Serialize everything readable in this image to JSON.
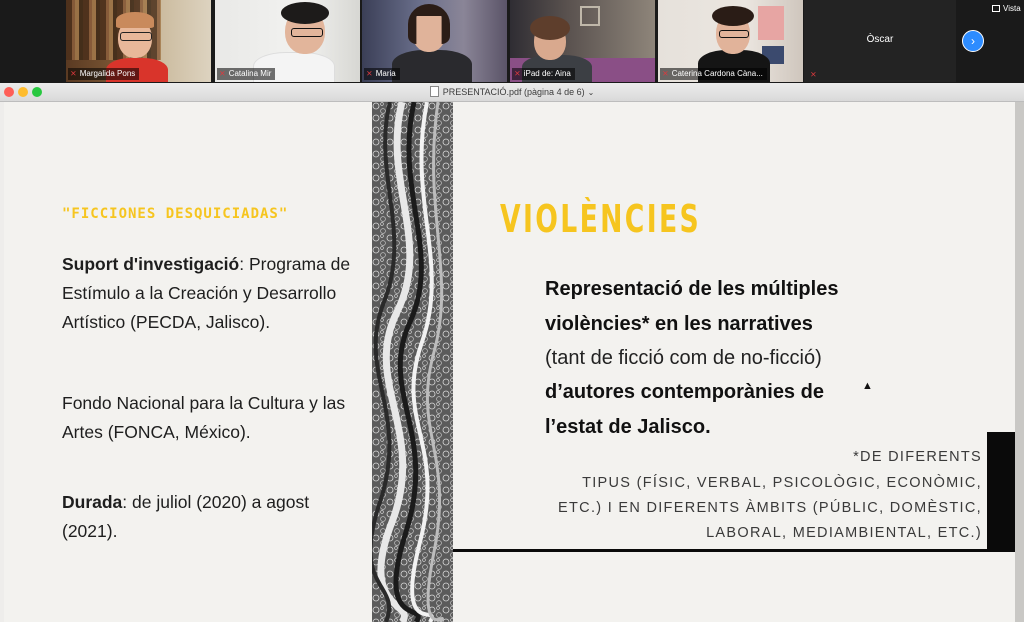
{
  "meeting": {
    "participants": [
      {
        "name": "Margalida Pons",
        "muted": true,
        "active": true
      },
      {
        "name": "Catalina Mir",
        "muted": true,
        "active": false
      },
      {
        "name": "Maria",
        "muted": true,
        "active": false
      },
      {
        "name": "iPad de: Aina",
        "muted": true,
        "active": false
      },
      {
        "name": "Caterina Cardona Càna...",
        "muted": true,
        "active": false
      }
    ],
    "overflow_participant": "Òscar",
    "view_label": "Vista"
  },
  "window": {
    "title": "PRESENTACIÓ.pdf (pàgina 4 de 6)"
  },
  "slide": {
    "left": {
      "subtitle": "\"FICCIONES DESQUICIADAS\"",
      "support_label": "Suport d'investigació",
      "support_text": ": Programa de Estímulo a la Creación y Desarrollo Artístico (PECDA, Jalisco).",
      "fonca_text": "Fondo Nacional para la Cultura y las Artes (FONCA, México).",
      "duration_label": "Durada",
      "duration_text": ": de juliol (2020) a agost (2021)."
    },
    "right": {
      "title": "VIOLÈNCIES",
      "line1": "Representació de les múltiples",
      "line2": "violències* en les narratives",
      "line3": "(tant de ficció  com de no-ficció)",
      "line4": "d’autores contemporànies de",
      "line5": "l’estat de Jalisco.",
      "note1": "*DE DIFERENTS",
      "note2": "TIPUS (FÍSIC, VERBAL, PSICOLÒGIC, ECONÒMIC,",
      "note3": "ETC.) I EN DIFERENTS ÀMBITS (PÚBLIC, DOMÈSTIC,",
      "note4": "LABORAL, MEDIAMBIENTAL, ETC.)"
    }
  },
  "colors": {
    "accent_yellow": "#f6c51f",
    "active_speaker": "#8fd14f",
    "muted_mic": "#e0393e",
    "zoom_blue": "#2d8cff"
  }
}
